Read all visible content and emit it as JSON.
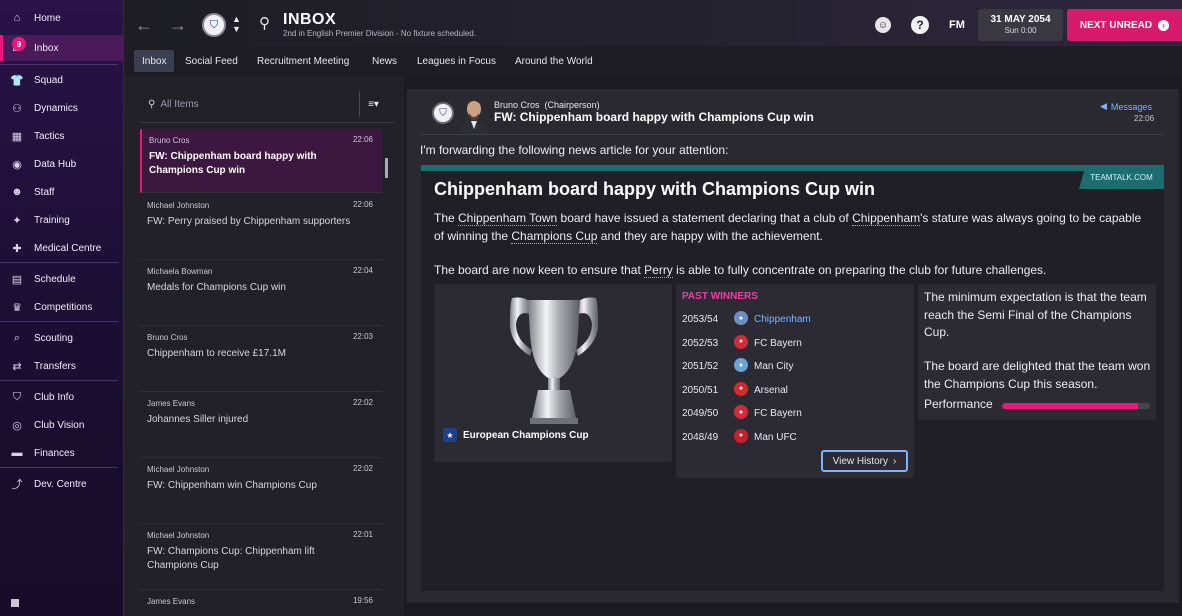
{
  "sidebar": {
    "items": [
      {
        "label": "Home",
        "icon": "home-icon"
      },
      {
        "label": "Inbox",
        "icon": "inbox-icon",
        "badge": "9"
      },
      {
        "label": "Squad",
        "icon": "squad-icon"
      },
      {
        "label": "Dynamics",
        "icon": "dynamics-icon"
      },
      {
        "label": "Tactics",
        "icon": "tactics-icon"
      },
      {
        "label": "Data Hub",
        "icon": "data-hub-icon"
      },
      {
        "label": "Staff",
        "icon": "staff-icon"
      },
      {
        "label": "Training",
        "icon": "training-icon"
      },
      {
        "label": "Medical Centre",
        "icon": "medical-icon"
      },
      {
        "label": "Schedule",
        "icon": "schedule-icon"
      },
      {
        "label": "Competitions",
        "icon": "trophy-icon"
      },
      {
        "label": "Scouting",
        "icon": "scouting-icon"
      },
      {
        "label": "Transfers",
        "icon": "transfers-icon"
      },
      {
        "label": "Club Info",
        "icon": "shield-icon"
      },
      {
        "label": "Club Vision",
        "icon": "vision-icon"
      },
      {
        "label": "Finances",
        "icon": "finances-icon"
      },
      {
        "label": "Dev. Centre",
        "icon": "dev-centre-icon"
      }
    ]
  },
  "header": {
    "title": "INBOX",
    "subtitle": "2nd in English Premier Division - No fixture scheduled.",
    "fm_label": "FM",
    "date": "31 MAY 2054",
    "time": "Sun 0:00",
    "next_button": "NEXT UNREAD"
  },
  "tabs": [
    "Inbox",
    "Social Feed",
    "Recruitment Meeting",
    "News",
    "Leagues in Focus",
    "Around the World"
  ],
  "search": {
    "placeholder": "All Items"
  },
  "messages": [
    {
      "from": "Bruno Cros",
      "time": "22:06",
      "subject": "FW: Chippenham board happy with Champions Cup win"
    },
    {
      "from": "Michael Johnston",
      "time": "22:06",
      "subject": "FW: Perry praised by Chippenham supporters"
    },
    {
      "from": "Michaela Bowman",
      "time": "22:04",
      "subject": "Medals for Champions Cup win"
    },
    {
      "from": "Bruno Cros",
      "time": "22:03",
      "subject": "Chippenham to receive £17.1M"
    },
    {
      "from": "James Evans",
      "time": "22:02",
      "subject": "Johannes Siller injured"
    },
    {
      "from": "Michael Johnston",
      "time": "22:02",
      "subject": "FW: Chippenham win Champions Cup"
    },
    {
      "from": "Michael Johnston",
      "time": "22:01",
      "subject": "FW: Champions Cup: Chippenham lift Champions Cup"
    },
    {
      "from": "James Evans",
      "time": "19:56",
      "subject": ""
    }
  ],
  "detail": {
    "from": "Bruno Cros",
    "role": "(Chairperson)",
    "subject": "FW: Chippenham board happy with Champions Cup win",
    "messages_link": "Messages",
    "time": "22:06",
    "intro": "I'm forwarding the following news article for your attention:"
  },
  "article": {
    "source": "TEAMTALK.COM",
    "title": "Chippenham board happy with Champions Cup win",
    "p1_a": "The ",
    "p1_club": "Chippenham Town",
    "p1_b": " board have issued a statement declaring that a club of ",
    "p1_c": "Chippenham",
    "p1_d": "'s stature was always going to be capable of winning the ",
    "p1_comp": "Champions Cup",
    "p1_e": " and they are happy with the achievement.",
    "p2_a": "The board are now keen to ensure that ",
    "p2_name": "Perry",
    "p2_b": " is able to fully concentrate on preparing the club for future challenges.",
    "competition": "European Champions Cup",
    "past_winners_title": "PAST WINNERS",
    "past_winners": [
      {
        "season": "2053/54",
        "club": "Chippenham",
        "color": "#6b8fc2",
        "link": true
      },
      {
        "season": "2052/53",
        "club": "FC Bayern",
        "color": "#d32a3a",
        "link": false
      },
      {
        "season": "2051/52",
        "club": "Man City",
        "color": "#6aa3d8",
        "link": false
      },
      {
        "season": "2050/51",
        "club": "Arsenal",
        "color": "#d52a2a",
        "link": false
      },
      {
        "season": "2049/50",
        "club": "FC Bayern",
        "color": "#d32a3a",
        "link": false
      },
      {
        "season": "2048/49",
        "club": "Man UFC",
        "color": "#c8202a",
        "link": false
      }
    ],
    "view_history": "View History",
    "side1_a": "The minimum expectation is that the team reach the ",
    "side1_b": "Semi Final",
    "side1_c": " of the ",
    "side1_d": "Champions Cup",
    "side1_e": ".",
    "side2_a": "The board are delighted that the team won the ",
    "side2_b": "Champions Cup",
    "side2_c": " this season.",
    "performance_label": "Performance",
    "performance_value": 0.92
  },
  "colors": {
    "accent": "#e8177a",
    "link": "#7db3ff",
    "teal": "#1b6d70"
  }
}
